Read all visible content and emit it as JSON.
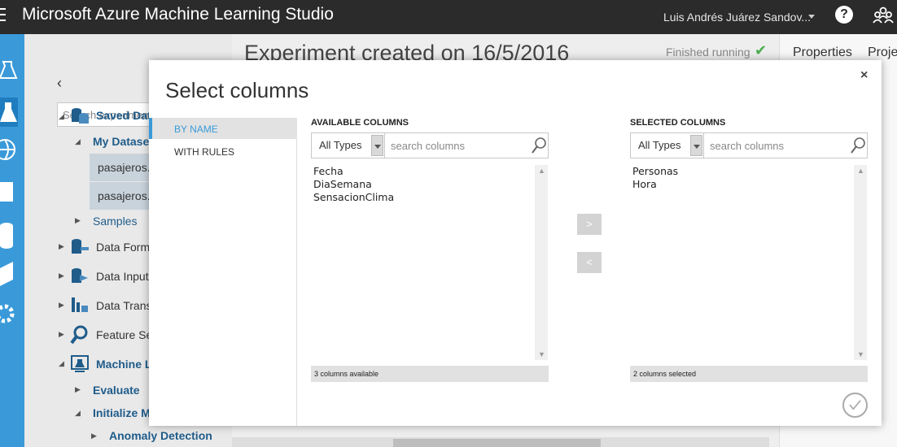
{
  "app": {
    "title": "Microsoft Azure Machine Learning Studio",
    "user": "Luis Andrés Juárez Sandov...",
    "help_label": "?"
  },
  "palette": {
    "collapse_glyph": "‹",
    "search_placeholder": "Search experiment items",
    "items": {
      "saved_datasets": "Saved Datasets",
      "my_datasets": "My Datasets",
      "dataset1": "pasajeros.csv",
      "dataset2": "pasajeros.txt",
      "samples": "Samples",
      "data_format": "Data Format Co",
      "data_input": "Data Input and",
      "data_transform": "Data Transform",
      "feature_selection": "Feature Selectio",
      "machine_learning": "Machine Learni",
      "evaluate": "Evaluate",
      "initialize_model": "Initialize Model",
      "anomaly_detection": "Anomaly Detection"
    }
  },
  "canvas": {
    "experiment_title": "Experiment created on 16/5/2016",
    "status": "Finished running"
  },
  "properties": {
    "tab1": "Properties",
    "tab2": "Proje"
  },
  "dialog": {
    "title": "Select columns",
    "close_glyph": "×",
    "nav": {
      "by_name": "BY NAME",
      "with_rules": "WITH RULES"
    },
    "available": {
      "header": "AVAILABLE COLUMNS",
      "type_value": "All Types",
      "search_placeholder": "search columns",
      "columns": [
        "Fecha",
        "DiaSemana",
        "SensacionClima"
      ],
      "footer": "3 columns available"
    },
    "selected": {
      "header": "SELECTED COLUMNS",
      "type_value": "All Types",
      "search_placeholder": "search columns",
      "columns": [
        "Personas",
        "Hora"
      ],
      "footer": "2 columns selected"
    },
    "move_right": ">",
    "move_left": "<"
  },
  "colors": {
    "topbar": "#2b2b2b",
    "rail": "#3a9ad9",
    "accent": "#3a9ad9",
    "success": "#4caf50"
  }
}
